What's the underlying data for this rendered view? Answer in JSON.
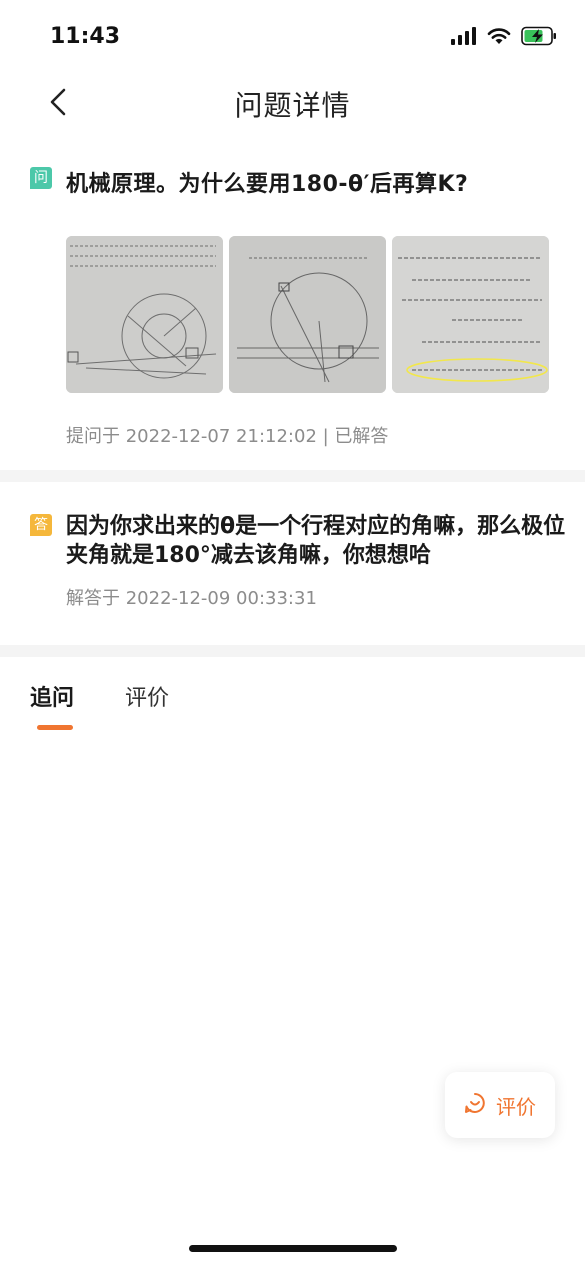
{
  "status_bar": {
    "time": "11:43"
  },
  "nav": {
    "title": "问题详情"
  },
  "question": {
    "badge": "问",
    "title": "机械原理。为什么要用180-θ′后再算K?",
    "thumbnails": [
      {
        "name": "question-image-1"
      },
      {
        "name": "question-image-2"
      },
      {
        "name": "question-image-3"
      }
    ],
    "meta": "提问于 2022-12-07 21:12:02 | 已解答"
  },
  "answer": {
    "badge": "答",
    "text": "因为你求出来的θ是一个行程对应的角嘛，那么极位夹角就是180°减去该角嘛，你想想哈",
    "meta": "解答于 2022-12-09 00:33:31"
  },
  "tabs": {
    "followup": "追问",
    "rate": "评价"
  },
  "rate_button": {
    "label": "评价"
  },
  "colors": {
    "accent": "#f07530",
    "question_badge": "#4cc8a9",
    "answer_badge": "#f5b73b",
    "meta_text": "#8c8c8c"
  }
}
